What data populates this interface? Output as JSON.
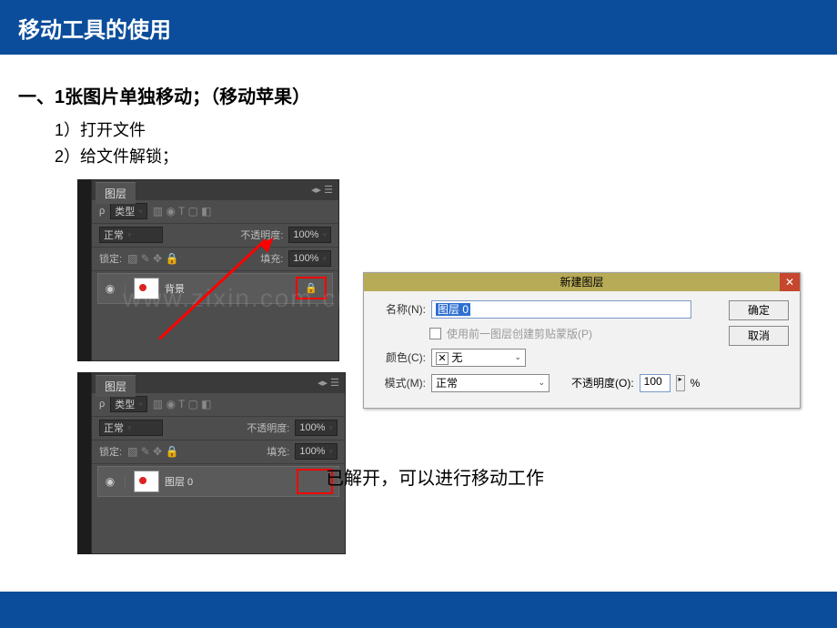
{
  "header": {
    "title": "移动工具的使用"
  },
  "section": {
    "title": "一、1张图片单独移动；（移动苹果）",
    "steps": {
      "s1": "1）打开文件",
      "s2": "2）给文件解锁；"
    }
  },
  "ps_panel": {
    "tab": "图层",
    "filter_label": "类型",
    "blend_mode": "正常",
    "opacity_label": "不透明度:",
    "opacity_value": "100%",
    "lock_label": "锁定:",
    "fill_label": "填充:",
    "fill_value": "100%",
    "layer1_name": "背景",
    "layer2_name": "图层 0"
  },
  "dialog": {
    "title": "新建图层",
    "name_label": "名称(N):",
    "name_value": "图层 0",
    "clip_checkbox": "使用前一图层创建剪贴蒙版(P)",
    "color_label": "颜色(C):",
    "color_value": "无",
    "mode_label": "模式(M):",
    "mode_value": "正常",
    "opacity_label": "不透明度(O):",
    "opacity_value": "100",
    "percent": "%",
    "ok": "确定",
    "cancel": "取消"
  },
  "caption": "已解开，可以进行移动工作",
  "watermark": "www.zixin.com.cn"
}
